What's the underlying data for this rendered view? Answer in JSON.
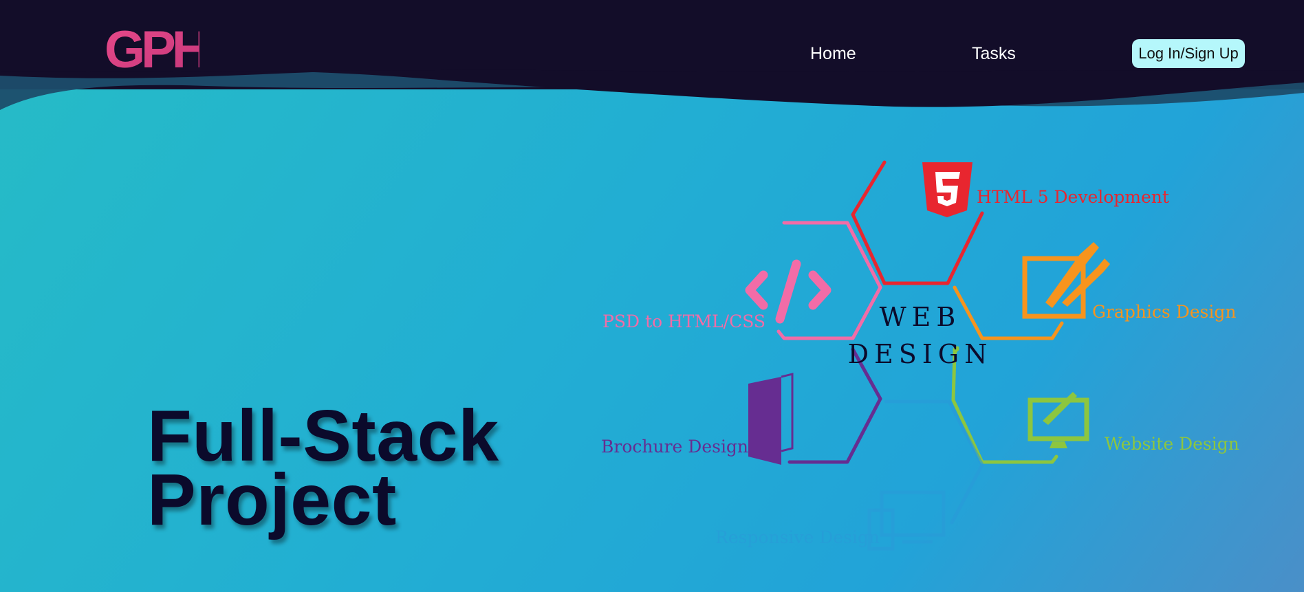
{
  "header": {
    "logo_text": "GPH",
    "nav": [
      {
        "label": "Home"
      },
      {
        "label": "Tasks"
      }
    ],
    "login_label": "Log In/Sign Up"
  },
  "hero": {
    "title_line1": "Full-Stack",
    "title_line2": "Project"
  },
  "diagram": {
    "center_line1": "WEB",
    "center_line2": "DESIGN",
    "items": [
      {
        "label": "HTML 5 Development",
        "icon": "html5-icon",
        "color": "#e8262f"
      },
      {
        "label": "PSD to HTML/CSS",
        "icon": "code-icon",
        "color": "#f26ca7"
      },
      {
        "label": "Graphics Design",
        "icon": "pen-tablet-icon",
        "color": "#f7941d"
      },
      {
        "label": "Brochure Design",
        "icon": "brochure-icon",
        "color": "#662d91"
      },
      {
        "label": "Website Design",
        "icon": "monitor-brush-icon",
        "color": "#8dc63f"
      },
      {
        "label": "Responsive Design",
        "icon": "devices-icon",
        "color": "#2a9ad8"
      }
    ]
  },
  "colors": {
    "topbar": "#130d29",
    "accent_button": "#b5f7fb",
    "title": "#0b0a2b",
    "logo_gradient": [
      "#e84a8a",
      "#c4367a"
    ]
  }
}
